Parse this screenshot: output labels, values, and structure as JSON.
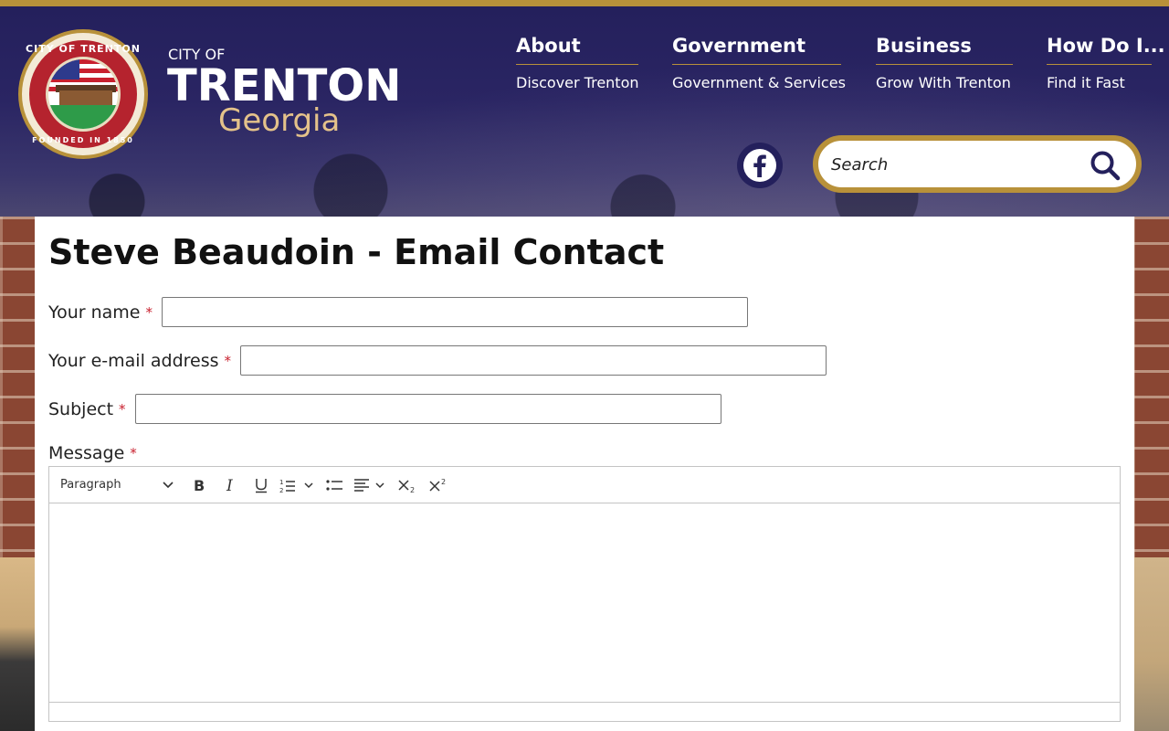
{
  "colors": {
    "gold": "#b8913a",
    "navy": "#24205c",
    "required": "#c8202e",
    "seal_red": "#b5232e",
    "seal_green": "#2e9b49"
  },
  "seal": {
    "top_text": "CITY OF TRENTON",
    "bottom_text": "FOUNDED IN 1850"
  },
  "logo": {
    "city_of": "CITY OF",
    "name": "TRENTON",
    "state": "Georgia"
  },
  "nav": [
    {
      "title": "About",
      "sub": "Discover Trenton"
    },
    {
      "title": "Government",
      "sub": "Government & Services"
    },
    {
      "title": "Business",
      "sub": "Grow With Trenton"
    },
    {
      "title": "How Do I...",
      "sub": "Find it Fast"
    }
  ],
  "social": {
    "icon": "facebook-icon"
  },
  "search": {
    "placeholder": "Search",
    "icon": "search-icon"
  },
  "page": {
    "title": "Steve Beaudoin - Email Contact",
    "required_marker": "*"
  },
  "form": {
    "name_label": "Your name",
    "email_label": "Your e-mail address",
    "subject_label": "Subject",
    "message_label": "Message",
    "name_value": "",
    "email_value": "",
    "subject_value": ""
  },
  "editor": {
    "format_select": "Paragraph",
    "toolbar_icons": [
      "bold-icon",
      "italic-icon",
      "underline-icon",
      "numbered-list-icon",
      "bulleted-list-icon",
      "align-icon",
      "subscript-icon",
      "superscript-icon"
    ]
  }
}
